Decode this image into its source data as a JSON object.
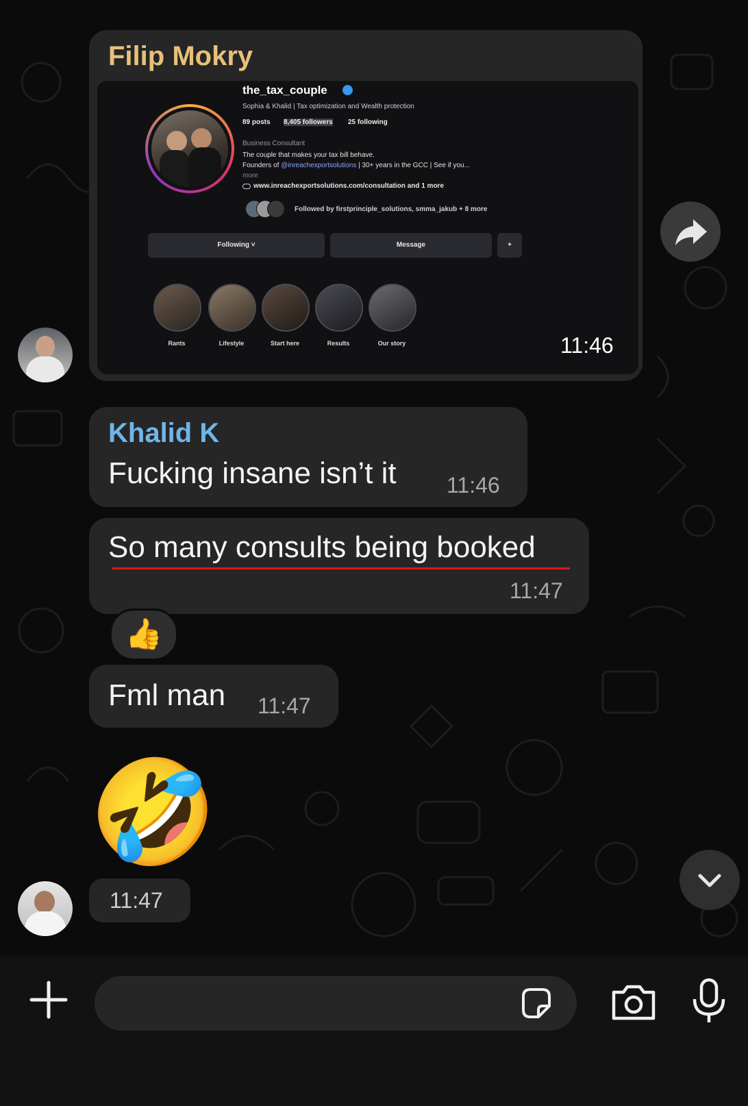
{
  "messages": {
    "forwarded": {
      "sender": "Filip Mokry",
      "time": "11:46",
      "ig": {
        "username": "the_tax_couple",
        "bio_line": "Sophia & Khalid | Tax optimization and Wealth protection",
        "posts": "89 posts",
        "followers": "8,405 followers",
        "following": "25 following",
        "category": "Business Consultant",
        "desc1": "The couple that makes your tax bill behave.",
        "desc2_prefix": "Founders of ",
        "desc2_link": "@inreachexportsolutions",
        "desc2_suffix": " | 30+ years in the GCC | See if you...",
        "more": "more",
        "website": "www.inreachexportsolutions.com/consultation and 1 more",
        "followed_by": "Followed by firstprinciple_solutions, smma_jakub + 8 more",
        "btn_following": "Following ˅",
        "btn_message": "Message",
        "btn_add": "+",
        "highlights": [
          "Rants",
          "Lifestyle",
          "Start here",
          "Results",
          "Our story"
        ]
      }
    },
    "khalid1": {
      "sender": "Khalid K",
      "text": "Fucking insane isn’t it",
      "time": "11:46"
    },
    "khalid2": {
      "text": "So many consults being booked",
      "time": "11:47",
      "reaction": "👍"
    },
    "khalid3": {
      "text": "Fml man",
      "time": "11:47"
    },
    "emoji_msg": {
      "emoji": "🤣",
      "time": "11:47"
    }
  },
  "colors": {
    "filip_name": "#e8c07a",
    "khalid_name": "#6fb6e8",
    "bubble": "#262626",
    "underline": "#e01818"
  },
  "icons": {
    "forward": "forward-arrow-icon",
    "scroll_down": "chevron-down-icon",
    "attach": "plus-icon",
    "sticker": "sticker-icon",
    "camera": "camera-icon",
    "mic": "microphone-icon"
  }
}
